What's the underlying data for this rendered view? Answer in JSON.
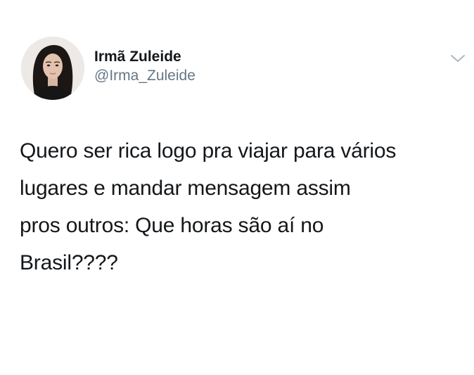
{
  "author": {
    "display_name": "Irmã Zuleide",
    "handle": "@Irma_Zuleide",
    "avatar": "profile-photo"
  },
  "tweet": {
    "text": "Quero ser rica logo pra viajar para vários\nlugares e mandar mensagem assim\npros outros: Que horas são aí no\nBrasil????"
  },
  "icons": {
    "menu": "chevron-down-icon"
  },
  "colors": {
    "text": "#14171a",
    "secondary": "#657786",
    "caret": "#aab8c2",
    "background": "#ffffff"
  }
}
